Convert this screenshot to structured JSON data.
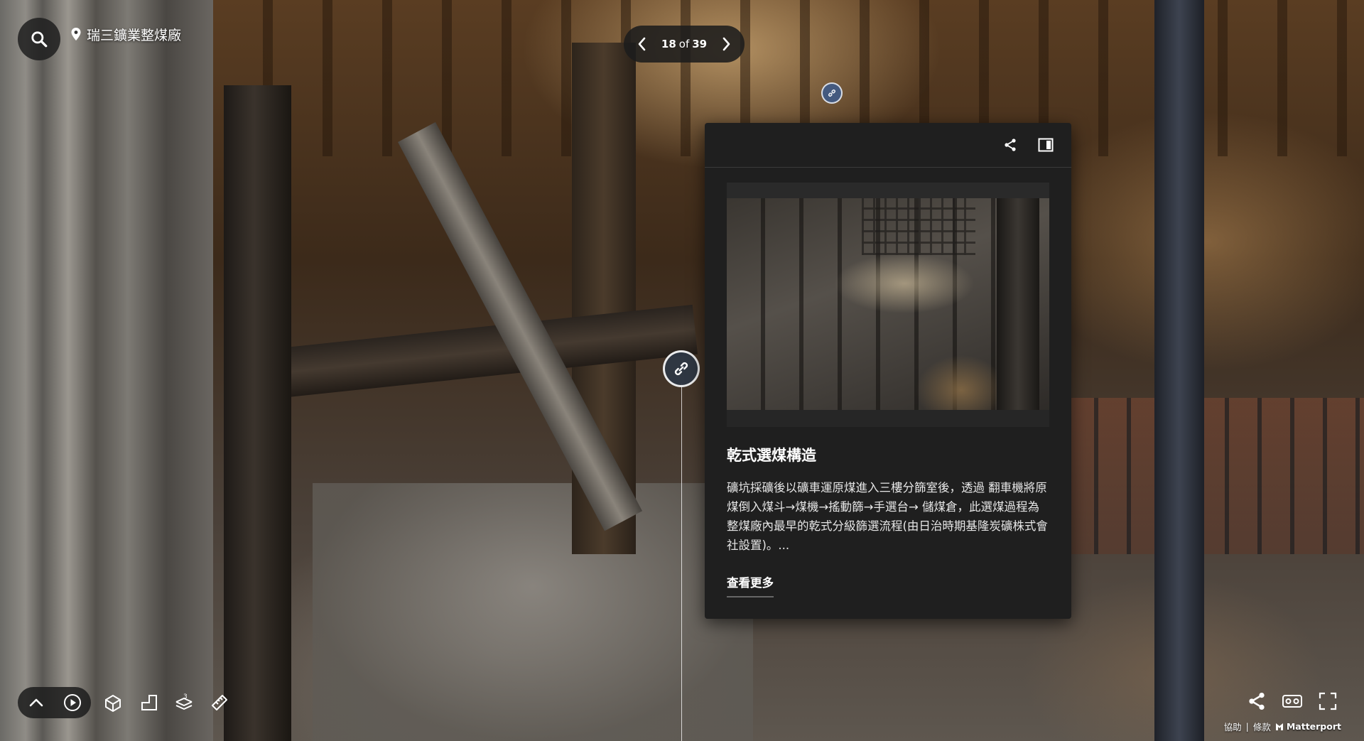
{
  "location": {
    "name": "瑞三鑛業整煤廠",
    "icon": "map-pin-icon"
  },
  "pager": {
    "current": "18",
    "separator": "of",
    "total": "39"
  },
  "panel": {
    "title": "乾式選煤構造",
    "description": "礦坑採礦後以礦車運原煤進入三樓分篩室後，透過 翻車機將原煤倒入煤斗→煤機→搖動篩→手選台→ 儲煤倉，此選煤過程為整煤廠內最早的乾式分級篩選流程(由日治時期基隆炭礦株式會社設置)。...",
    "more_label": "查看更多",
    "share_icon": "share-icon",
    "sidebar_icon": "panel-toggle-icon"
  },
  "toolbar": {
    "left": [
      "chevron-up-icon",
      "play-icon",
      "dollhouse-icon",
      "floorplan-icon",
      "floors-icon",
      "measure-icon"
    ],
    "floors_badge": "3",
    "right": [
      "share-icon",
      "vr-icon",
      "fullscreen-icon"
    ]
  },
  "footer": {
    "help": "協助",
    "divider": "|",
    "terms": "條款",
    "brand": "Matterport"
  }
}
